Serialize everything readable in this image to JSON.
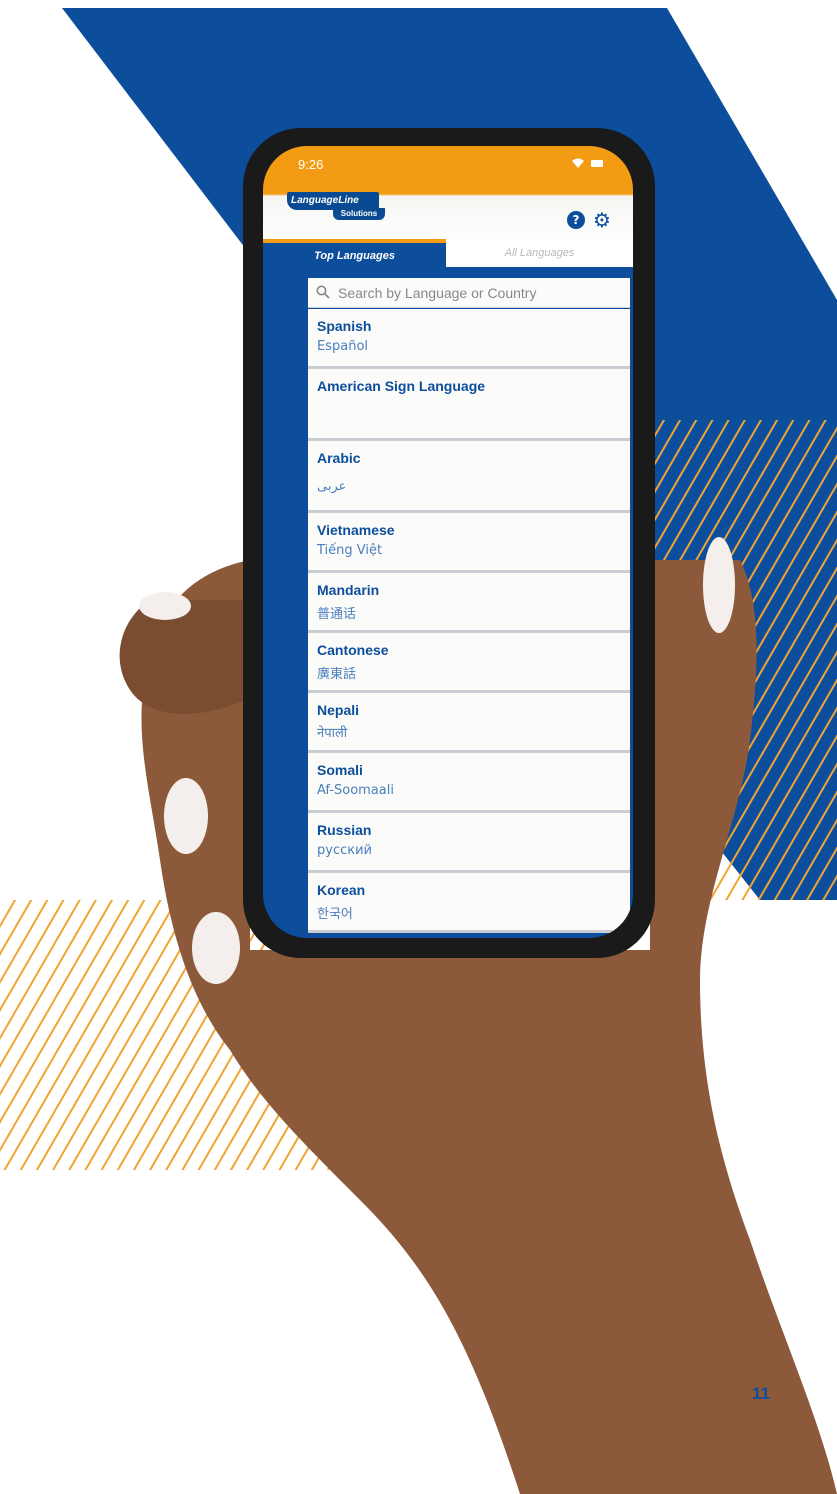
{
  "status_bar": {
    "time": "9:26"
  },
  "header": {
    "logo_name": "LanguageLine",
    "logo_sub": "Solutions"
  },
  "tabs": [
    {
      "label": "Top Languages",
      "active": true
    },
    {
      "label": "All Languages",
      "active": false
    }
  ],
  "search": {
    "placeholder": "Search by Language or Country"
  },
  "languages": [
    {
      "name": "Spanish",
      "native": "Español"
    },
    {
      "name": "American Sign Language",
      "native": ""
    },
    {
      "name": "Arabic",
      "native": "عربى"
    },
    {
      "name": "Vietnamese",
      "native": "Tiếng Việt"
    },
    {
      "name": "Mandarin",
      "native": "普通话"
    },
    {
      "name": "Cantonese",
      "native": "廣東話"
    },
    {
      "name": "Nepali",
      "native": "नेपाली"
    },
    {
      "name": "Somali",
      "native": "Af-Soomaali"
    },
    {
      "name": "Russian",
      "native": "русский"
    },
    {
      "name": "Korean",
      "native": "한국어"
    }
  ],
  "page_number": "11",
  "colors": {
    "brand_blue": "#0d4e9c",
    "brand_orange": "#f39b12",
    "stripe_gold": "#f0a431"
  }
}
